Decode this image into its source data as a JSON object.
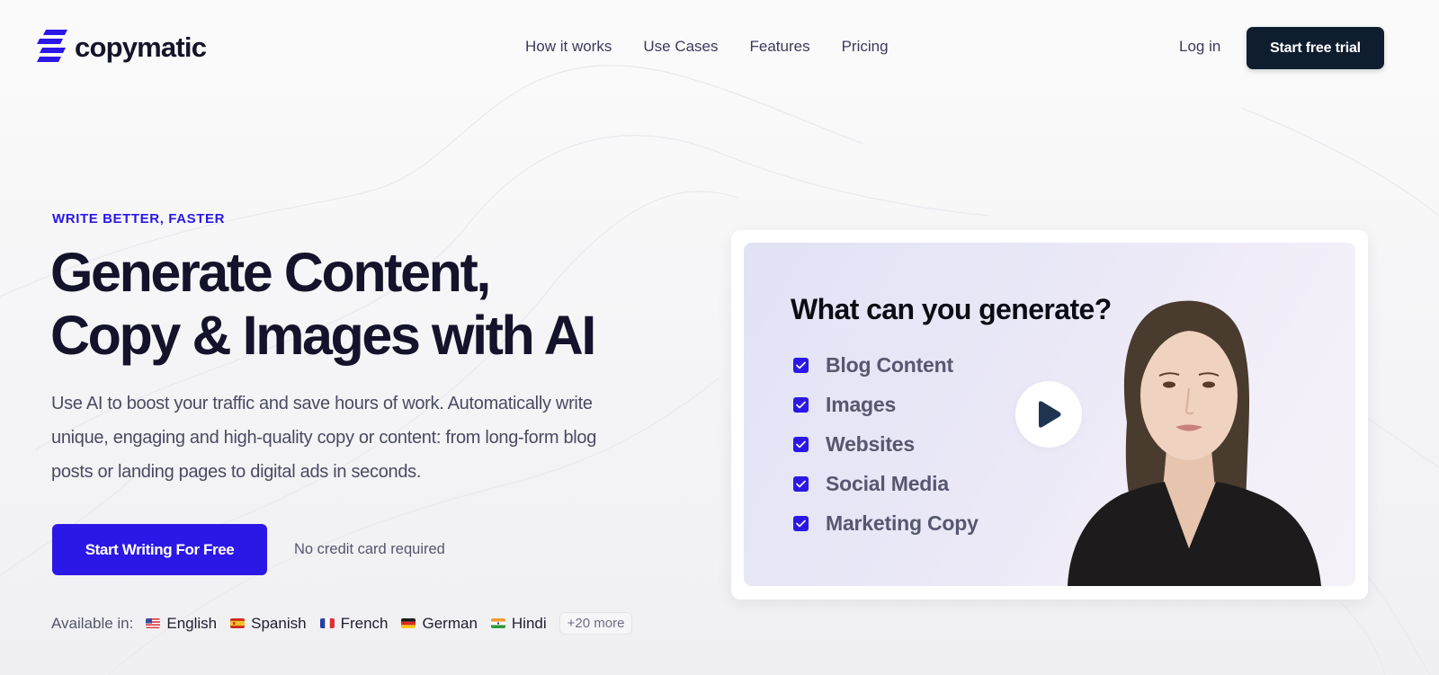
{
  "brand": {
    "name": "copymatic",
    "accent_color": "#2b17e6",
    "dark_color": "#0f1e2e"
  },
  "nav": {
    "items": [
      {
        "label": "How it works"
      },
      {
        "label": "Use Cases"
      },
      {
        "label": "Features"
      },
      {
        "label": "Pricing"
      }
    ],
    "login_label": "Log in",
    "trial_label": "Start free trial"
  },
  "hero": {
    "eyebrow": "WRITE BETTER, FASTER",
    "headline_line1": "Generate Content,",
    "headline_line2": "Copy & Images with AI",
    "subtext": "Use AI to boost your traffic and save hours of work. Automatically write unique, engaging and high-quality copy or content: from long-form blog posts or landing pages to digital ads in seconds.",
    "cta_label": "Start Writing For Free",
    "cta_note": "No credit card required",
    "languages_label": "Available in:",
    "languages": [
      {
        "name": "English",
        "flag": "us-flag-icon"
      },
      {
        "name": "Spanish",
        "flag": "es-flag-icon"
      },
      {
        "name": "French",
        "flag": "fr-flag-icon"
      },
      {
        "name": "German",
        "flag": "de-flag-icon"
      },
      {
        "name": "Hindi",
        "flag": "in-flag-icon"
      }
    ],
    "more_languages": "+20 more"
  },
  "video": {
    "title": "What can you generate?",
    "items": [
      {
        "label": "Blog Content",
        "checked": true
      },
      {
        "label": "Images",
        "checked": true
      },
      {
        "label": "Websites",
        "checked": true
      },
      {
        "label": "Social Media",
        "checked": true
      },
      {
        "label": "Marketing Copy",
        "checked": true
      }
    ],
    "play_icon": "play-icon"
  }
}
